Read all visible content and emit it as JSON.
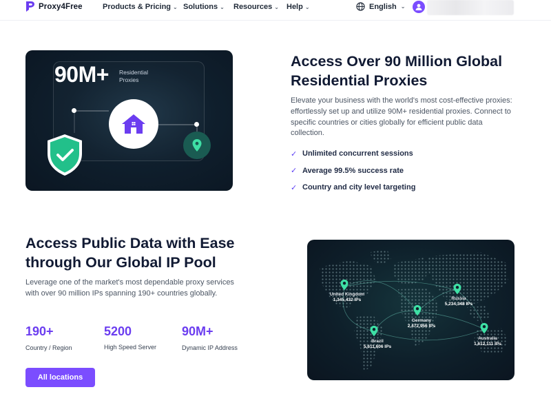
{
  "nav": {
    "brand": "Proxy4Free",
    "items": [
      {
        "label": "Products & Pricing"
      },
      {
        "label": "Solutions"
      },
      {
        "label": "Resources"
      },
      {
        "label": "Help"
      }
    ],
    "language": "English"
  },
  "hero": {
    "card": {
      "big_number": "90M+",
      "label": "Residential Proxies"
    },
    "title": "Access Over 90 Million Global Residential Proxies",
    "description": "Elevate your business with the world's most cost-effective proxies: effortlessly set up and utilize 90M+ residential proxies. Connect to specific countries or cities globally for efficient public data collection.",
    "features": [
      "Unlimited concurrent sessions",
      "Average 99.5% success rate",
      "Country and city level targeting"
    ]
  },
  "pool": {
    "title": "Access Public Data with Ease through Our Global IP Pool",
    "description": "Leverage one of the market's most dependable proxy services with over 90 million IPs spanning 190+ countries globally.",
    "stats": [
      {
        "value": "190+",
        "label": "Country / Region"
      },
      {
        "value": "5200",
        "label": "High Speed Server"
      },
      {
        "value": "90M+",
        "label": "Dynamic IP Address"
      }
    ],
    "button": "All locations",
    "map": {
      "locations": [
        {
          "name": "United Kingdom",
          "ips": "1,345,432 IPs"
        },
        {
          "name": "Russia",
          "ips": "5,234,348 IPs"
        },
        {
          "name": "Germany",
          "ips": "2,472,956 IPs"
        },
        {
          "name": "Brazil",
          "ips": "5,611,606 IPs"
        },
        {
          "name": "Australia",
          "ips": "1,612,111 IPs"
        }
      ]
    }
  },
  "colors": {
    "accent": "#7b4dff",
    "stat": "#6b3df0",
    "shield": "#22c08a",
    "pin": "#3ee0a5"
  }
}
